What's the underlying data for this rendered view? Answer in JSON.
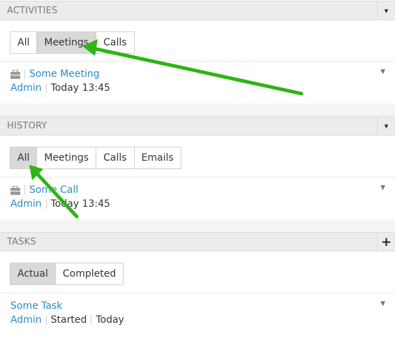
{
  "activities": {
    "title": "ACTIVITIES",
    "action_icon": "caret-down-icon",
    "action_glyph": "▾",
    "tabs": [
      {
        "label": "All",
        "active": false
      },
      {
        "label": "Meetings",
        "active": true
      },
      {
        "label": "Calls",
        "active": false
      }
    ],
    "records": [
      {
        "name": "Some Meeting",
        "assignee": "Admin",
        "date": "Today 13:45"
      }
    ]
  },
  "history": {
    "title": "HISTORY",
    "action_icon": "caret-down-icon",
    "action_glyph": "▾",
    "tabs": [
      {
        "label": "All",
        "active": true
      },
      {
        "label": "Meetings",
        "active": false
      },
      {
        "label": "Calls",
        "active": false
      },
      {
        "label": "Emails",
        "active": false
      }
    ],
    "records": [
      {
        "name": "Some Call",
        "assignee": "Admin",
        "date": "Today 13:45"
      }
    ]
  },
  "tasks": {
    "title": "TASKS",
    "action_icon": "plus-icon",
    "action_glyph": "+",
    "tabs": [
      {
        "label": "Actual",
        "active": true
      },
      {
        "label": "Completed",
        "active": false
      }
    ],
    "records": [
      {
        "name": "Some Task",
        "assignee": "Admin",
        "status": "Started",
        "date": "Today"
      }
    ]
  },
  "record_menu_glyph": "▼",
  "colors": {
    "link": "#2a8bc6",
    "annotation_arrow": "#2db514",
    "header_bg": "#ececec",
    "active_tab_bg": "#d9d9d9"
  }
}
